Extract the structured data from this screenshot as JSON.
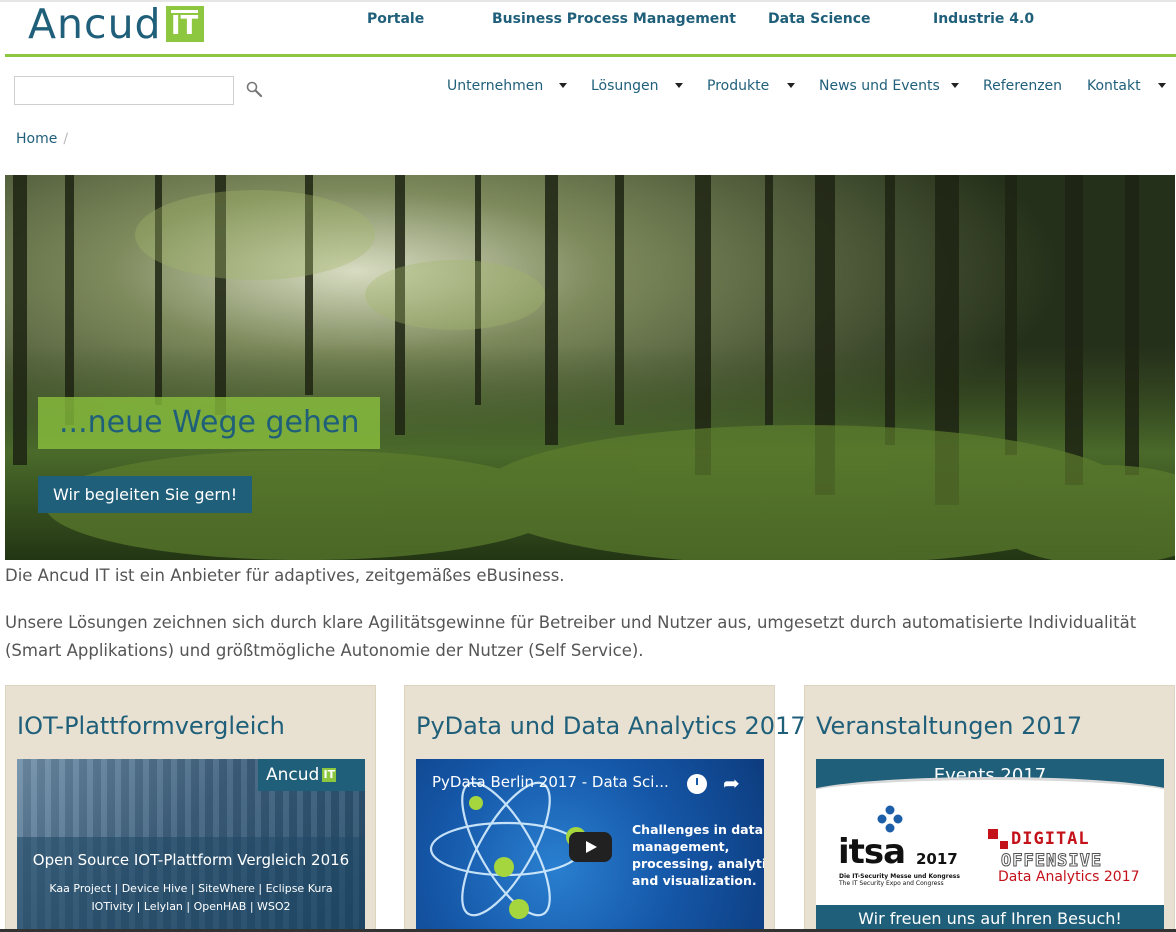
{
  "logo": {
    "text": "Ancud",
    "badge": "IT"
  },
  "top_nav": [
    "Portale",
    "Business Process Management",
    "Data Science",
    "Industrie 4.0"
  ],
  "search": {
    "placeholder": ""
  },
  "main_nav": [
    {
      "label": "Unternehmen",
      "has_submenu": true
    },
    {
      "label": "Lösungen",
      "has_submenu": true
    },
    {
      "label": "Produkte",
      "has_submenu": true
    },
    {
      "label": "News und Events",
      "has_submenu": true
    },
    {
      "label": "Referenzen",
      "has_submenu": false
    },
    {
      "label": "Kontakt",
      "has_submenu": true
    }
  ],
  "breadcrumb": {
    "home": "Home",
    "separator": "/"
  },
  "hero": {
    "title": "...neue Wege gehen",
    "button": "Wir begleiten Sie gern!"
  },
  "intro": {
    "p1": "Die Ancud IT ist ein Anbieter für adaptives, zeitgemäßes eBusiness.",
    "p2": "Unsere Lösungen zeichnen sich durch klare Agilitätsgewinne für Betreiber und Nutzer aus, umgesetzt durch automatisierte Individualität (Smart Applikations) und größtmögliche Autonomie der Nutzer (Self Service)."
  },
  "cards": [
    {
      "title": "IOT-Plattformvergleich",
      "image": {
        "brand": "Ancud",
        "brand_badge": "IT",
        "headline": "Open Source IOT-Plattform Vergleich 2016",
        "line1": "Kaa Project | Device Hive | SiteWhere | Eclipse Kura",
        "line2": "IOTivity | Lelylan | OpenHAB | WSO2"
      }
    },
    {
      "title": "PyData und Data Analytics 2017",
      "video": {
        "title": "PyData Berlin 2017 - Data Sci...",
        "overlay_text": "Challenges in data\nmanagement,\nprocessing, analytics,\nand visualization."
      }
    },
    {
      "title": "Veranstaltungen 2017",
      "image": {
        "header": "Events 2017",
        "itsa": "itsa",
        "itsa_year": "2017",
        "itsa_sub1": "Die IT-Security Messe und Kongress",
        "itsa_sub2": "The IT Security Expo and Congress",
        "digital": "DIGITAL",
        "offensive": "OFFENSIVE",
        "data_analytics": "Data Analytics 2017",
        "footer": "Wir freuen uns auf Ihren Besuch!"
      }
    }
  ],
  "colors": {
    "brand_blue": "#1f5f7a",
    "brand_green": "#8dc63f",
    "card_bg": "#e8e1d1"
  }
}
